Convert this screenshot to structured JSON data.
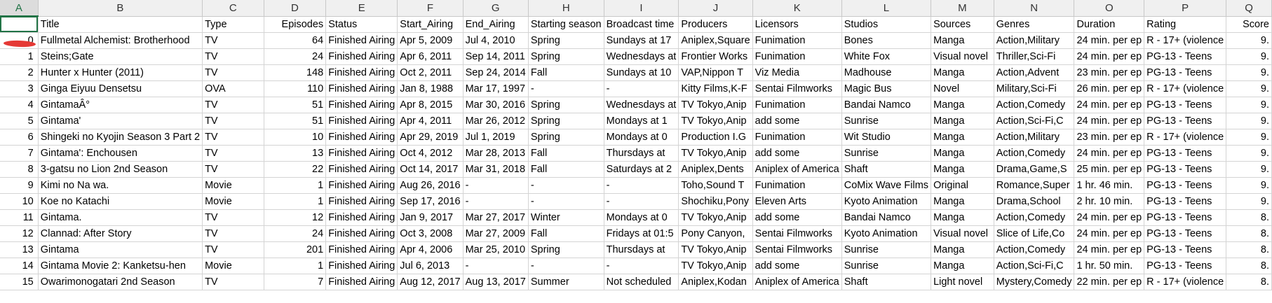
{
  "columns": [
    "A",
    "B",
    "C",
    "D",
    "E",
    "F",
    "G",
    "H",
    "I",
    "J",
    "K",
    "L",
    "M",
    "N",
    "O",
    "P",
    "Q"
  ],
  "header_row": [
    "",
    "Title",
    "Type",
    "Episodes",
    "Status",
    "Start_Airing",
    "End_Airing",
    "Starting season",
    "Broadcast time",
    "Producers",
    "Licensors",
    "Studios",
    "Sources",
    "Genres",
    "Duration",
    "Rating",
    "Score"
  ],
  "rows": [
    [
      "0",
      "Fullmetal Alchemist: Brotherhood",
      "TV",
      "64",
      "Finished Airing",
      "Apr 5, 2009",
      "Jul 4, 2010",
      "Spring",
      "Sundays at 17",
      "Aniplex,Square",
      "Funimation",
      "Bones",
      "Manga",
      "Action,Military",
      "24 min. per ep",
      "R - 17+ (violence",
      "9."
    ],
    [
      "1",
      "Steins;Gate",
      "TV",
      "24",
      "Finished Airing",
      "Apr 6, 2011",
      "Sep 14, 2011",
      "Spring",
      "Wednesdays at",
      "Frontier Works",
      "Funimation",
      "White Fox",
      "Visual novel",
      "Thriller,Sci-Fi",
      "24 min. per ep",
      "PG-13 - Teens",
      "9."
    ],
    [
      "2",
      "Hunter x Hunter (2011)",
      "TV",
      "148",
      "Finished Airing",
      "Oct 2, 2011",
      "Sep 24, 2014",
      "Fall",
      "Sundays at 10",
      "VAP,Nippon T",
      "Viz Media",
      "Madhouse",
      "Manga",
      "Action,Advent",
      "23 min. per ep",
      "PG-13 - Teens",
      "9."
    ],
    [
      "3",
      "Ginga Eiyuu Densetsu",
      "OVA",
      "110",
      "Finished Airing",
      "Jan 8, 1988",
      "Mar 17, 1997",
      "-",
      "-",
      "Kitty Films,K-F",
      "Sentai Filmworks",
      "Magic Bus",
      "Novel",
      "Military,Sci-Fi",
      "26 min. per ep",
      "R - 17+ (violence",
      "9."
    ],
    [
      "4",
      "GintamaÂ°",
      "TV",
      "51",
      "Finished Airing",
      "Apr 8, 2015",
      "Mar 30, 2016",
      "Spring",
      "Wednesdays at",
      "TV Tokyo,Anip",
      "Funimation",
      "Bandai Namco",
      "Manga",
      "Action,Comedy",
      "24 min. per ep",
      "PG-13 - Teens",
      "9."
    ],
    [
      "5",
      "Gintama'",
      "TV",
      "51",
      "Finished Airing",
      "Apr 4, 2011",
      "Mar 26, 2012",
      "Spring",
      "Mondays at 1",
      "TV Tokyo,Anip",
      "add some",
      "Sunrise",
      "Manga",
      "Action,Sci-Fi,C",
      "24 min. per ep",
      "PG-13 - Teens",
      "9."
    ],
    [
      "6",
      "Shingeki no Kyojin Season 3 Part 2",
      "TV",
      "10",
      "Finished Airing",
      "Apr 29, 2019",
      "Jul 1, 2019",
      "Spring",
      "Mondays at 0",
      "Production I.G",
      "Funimation",
      "Wit Studio",
      "Manga",
      "Action,Military",
      "23 min. per ep",
      "R - 17+ (violence",
      "9."
    ],
    [
      "7",
      "Gintama': Enchousen",
      "TV",
      "13",
      "Finished Airing",
      "Oct 4, 2012",
      "Mar 28, 2013",
      "Fall",
      "Thursdays at",
      "TV Tokyo,Anip",
      "add some",
      "Sunrise",
      "Manga",
      "Action,Comedy",
      "24 min. per ep",
      "PG-13 - Teens",
      "9."
    ],
    [
      "8",
      "3-gatsu no Lion 2nd Season",
      "TV",
      "22",
      "Finished Airing",
      "Oct 14, 2017",
      "Mar 31, 2018",
      "Fall",
      "Saturdays at 2",
      "Aniplex,Dents",
      "Aniplex of America",
      "Shaft",
      "Manga",
      "Drama,Game,S",
      "25 min. per ep",
      "PG-13 - Teens",
      "9."
    ],
    [
      "9",
      "Kimi no Na wa.",
      "Movie",
      "1",
      "Finished Airing",
      "Aug 26, 2016",
      "-",
      "-",
      "-",
      "Toho,Sound T",
      "Funimation",
      "CoMix Wave Films",
      "Original",
      "Romance,Super",
      "1 hr. 46 min.",
      "PG-13 - Teens",
      "9."
    ],
    [
      "10",
      "Koe no Katachi",
      "Movie",
      "1",
      "Finished Airing",
      "Sep 17, 2016",
      "-",
      "-",
      "-",
      "Shochiku,Pony",
      "Eleven Arts",
      "Kyoto Animation",
      "Manga",
      "Drama,School",
      "2 hr. 10 min.",
      "PG-13 - Teens",
      "9."
    ],
    [
      "11",
      "Gintama.",
      "TV",
      "12",
      "Finished Airing",
      "Jan 9, 2017",
      "Mar 27, 2017",
      "Winter",
      "Mondays at 0",
      "TV Tokyo,Anip",
      "add some",
      "Bandai Namco",
      "Manga",
      "Action,Comedy",
      "24 min. per ep",
      "PG-13 - Teens",
      "8."
    ],
    [
      "12",
      "Clannad: After Story",
      "TV",
      "24",
      "Finished Airing",
      "Oct 3, 2008",
      "Mar 27, 2009",
      "Fall",
      "Fridays at 01:5",
      "Pony Canyon,",
      "Sentai Filmworks",
      "Kyoto Animation",
      "Visual novel",
      "Slice of Life,Co",
      "24 min. per ep",
      "PG-13 - Teens",
      "8."
    ],
    [
      "13",
      "Gintama",
      "TV",
      "201",
      "Finished Airing",
      "Apr 4, 2006",
      "Mar 25, 2010",
      "Spring",
      "Thursdays at",
      "TV Tokyo,Anip",
      "Sentai Filmworks",
      "Sunrise",
      "Manga",
      "Action,Comedy",
      "24 min. per ep",
      "PG-13 - Teens",
      "8."
    ],
    [
      "14",
      "Gintama Movie 2: Kanketsu-hen",
      "Movie",
      "1",
      "Finished Airing",
      "Jul 6, 2013",
      "-",
      "-",
      "-",
      "TV Tokyo,Anip",
      "add some",
      "Sunrise",
      "Manga",
      "Action,Sci-Fi,C",
      "1 hr. 50 min.",
      "PG-13 - Teens",
      "8."
    ],
    [
      "15",
      "Owarimonogatari 2nd Season",
      "TV",
      "7",
      "Finished Airing",
      "Aug 12, 2017",
      "Aug 13, 2017",
      "Summer",
      "Not scheduled",
      "Aniplex,Kodan",
      "Aniplex of America",
      "Shaft",
      "Light novel",
      "Mystery,Comedy",
      "22 min. per ep",
      "R - 17+ (violence",
      "8."
    ]
  ]
}
